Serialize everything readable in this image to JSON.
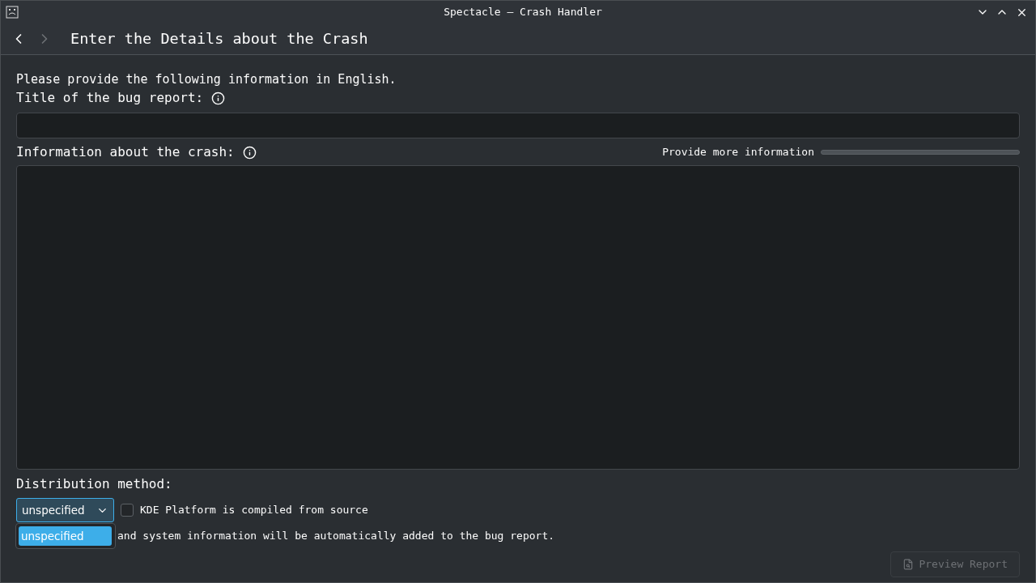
{
  "window": {
    "title": "Spectacle — Crash Handler"
  },
  "header": {
    "title": "Enter the Details about the Crash",
    "back_disabled": false,
    "forward_disabled": true
  },
  "intro": "Please provide the following information in English.",
  "title_field": {
    "label": "Title of the bug report:"
  },
  "info_field": {
    "label": "Information about the crash:"
  },
  "quality": {
    "label": "Provide more information",
    "level": 0
  },
  "distribution": {
    "label": "Distribution method:",
    "value": "unspecified",
    "expanded": true,
    "options": [
      {
        "label": "unspecified",
        "selected": true
      }
    ]
  },
  "compiled_from_source": {
    "label": "KDE Platform is compiled from source",
    "checked": false
  },
  "note": "and system information will be automatically added to the bug report.",
  "preview_button": {
    "label": "Preview Report",
    "disabled": true
  }
}
